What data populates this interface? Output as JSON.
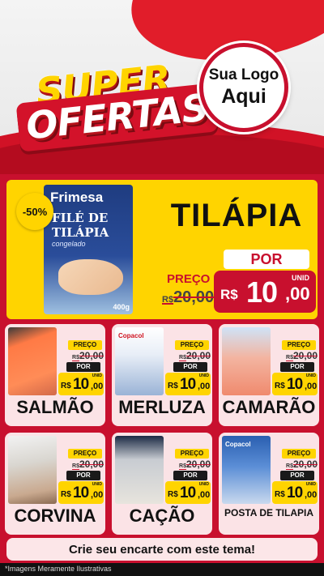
{
  "header": {
    "title_line1": "SUPER",
    "title_line2": "OFERTAS",
    "logo_line1": "Sua Logo",
    "logo_line2": "Aqui"
  },
  "featured": {
    "discount_badge": "-50%",
    "package_brand": "Frimesa",
    "package_line1": "FILÉ DE",
    "package_line2": "TILÁPIA",
    "package_line3": "congelado",
    "package_weight": "400g",
    "product_name": "TILÁPIA",
    "old_label": "PREÇO",
    "old_currency": "R$",
    "old_price": "20,00",
    "new_label": "POR",
    "unit": "UNID",
    "currency": "R$",
    "price_int": "10",
    "price_cents": ",00"
  },
  "labels": {
    "preco": "PREÇO",
    "por": "POR",
    "unid": "UNID",
    "currency": "R$",
    "old_currency": "R$",
    "old_price": "20,00",
    "price_int": "10",
    "price_cents": ",00"
  },
  "products": [
    {
      "name": "SALMÃO",
      "pack_label": ""
    },
    {
      "name": "MERLUZA",
      "pack_label": "Copacol"
    },
    {
      "name": "CAMARÃO",
      "pack_label": ""
    },
    {
      "name": "CORVINA",
      "pack_label": ""
    },
    {
      "name": "CAÇÃO",
      "pack_label": ""
    },
    {
      "name": "POSTA DE TILAPIA",
      "pack_label": "Copacol"
    }
  ],
  "footer": {
    "cta": "Crie seu encarte com este tema!",
    "disclaimer": "*Imagens Meramente Ilustrativas"
  },
  "colors": {
    "brand_red": "#c8102e",
    "accent_yellow": "#ffd400",
    "card_bg": "#fbe3e6"
  }
}
